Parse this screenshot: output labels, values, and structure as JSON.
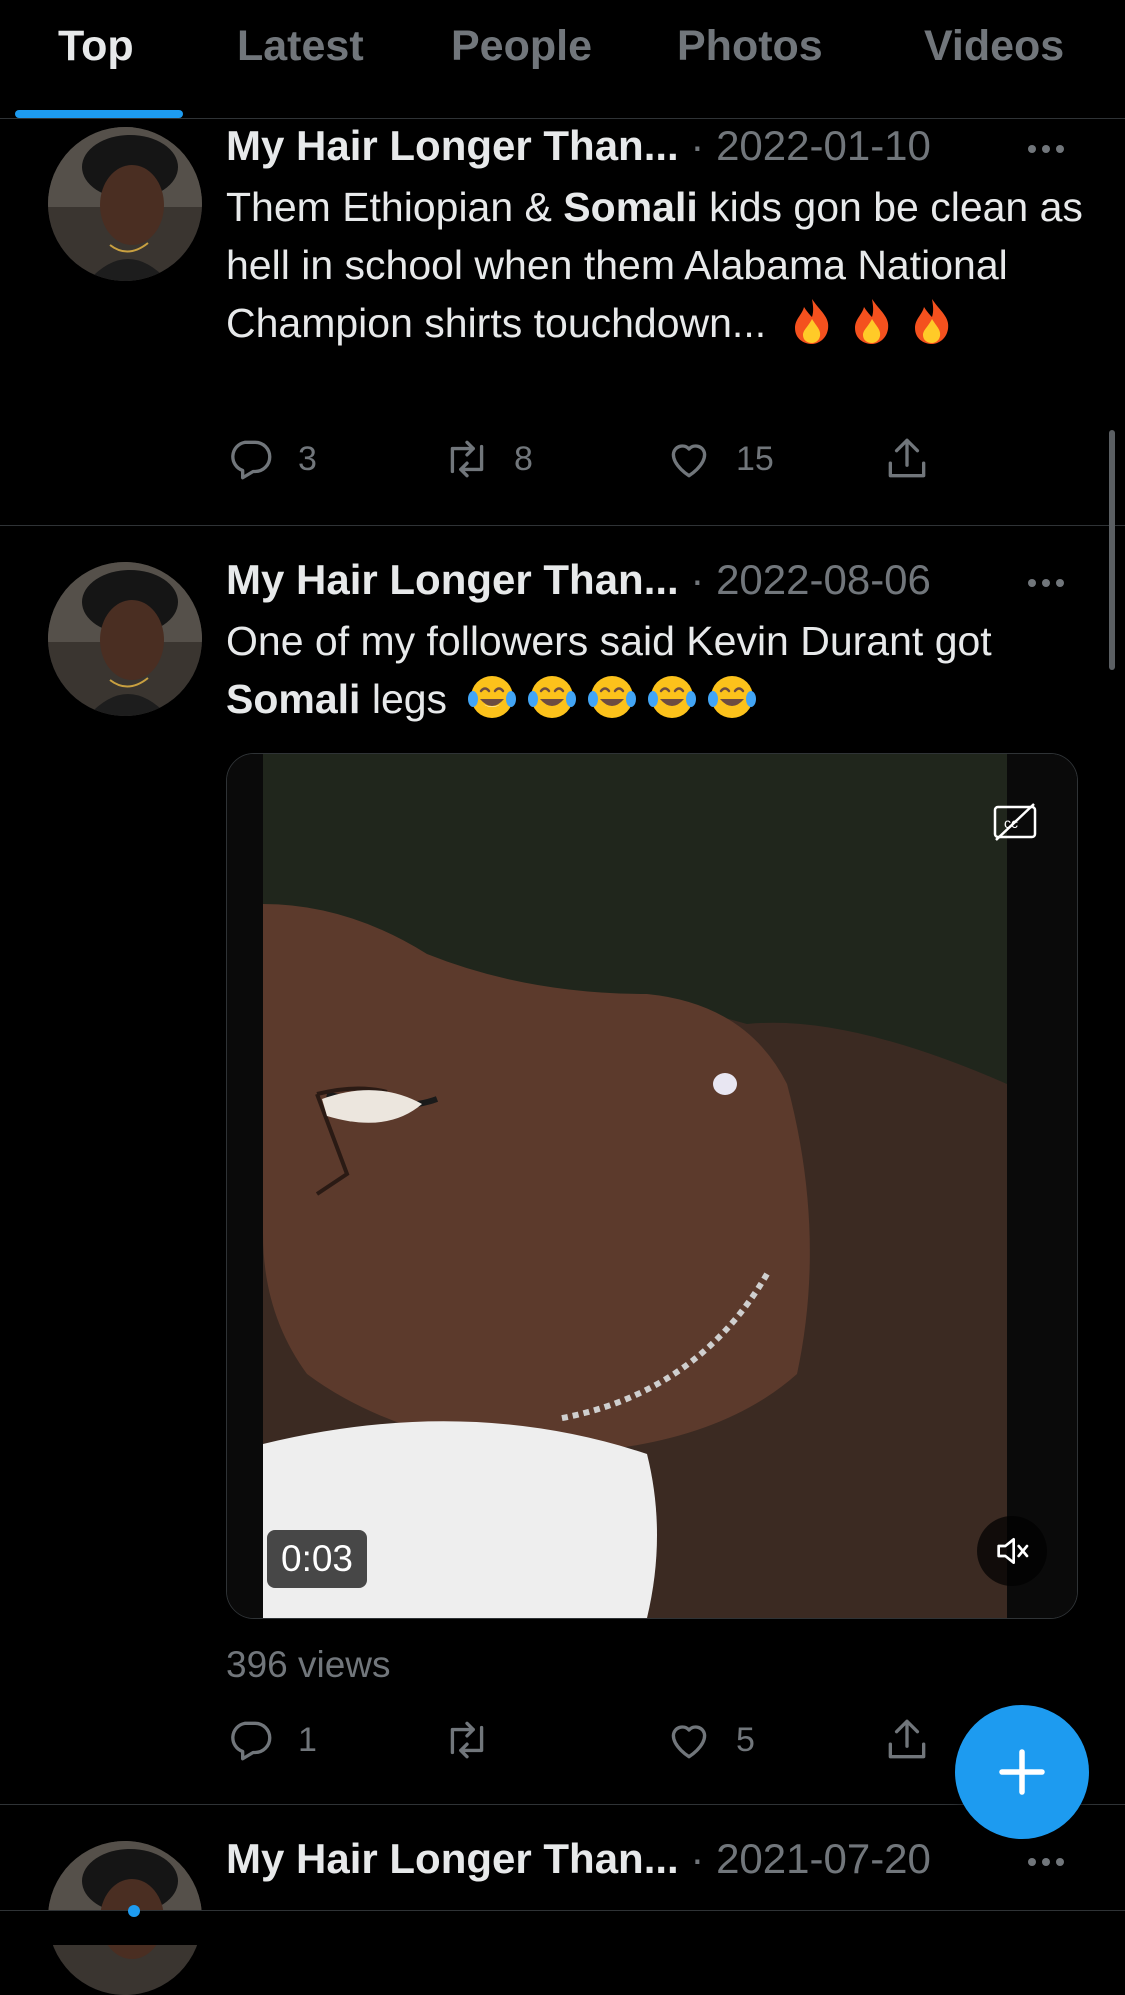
{
  "tabs": [
    {
      "label": "Top",
      "active": true
    },
    {
      "label": "Latest"
    },
    {
      "label": "People"
    },
    {
      "label": "Photos"
    },
    {
      "label": "Videos"
    }
  ],
  "colors": {
    "accent": "#1d9bf0",
    "background": "#000000",
    "muted": "#71767b",
    "text": "#e7e9ea"
  },
  "tweets": [
    {
      "author": "My Hair Longer Than...",
      "separator": "·",
      "date": "2022-01-10",
      "text_parts": [
        "Them Ethiopian & ",
        "Somali",
        " kids gon be clean as hell in school when them Alabama National Champion shirts touchdown... "
      ],
      "emojis": [
        "fire",
        "fire",
        "fire"
      ],
      "replies": "3",
      "retweets": "8",
      "likes": "15"
    },
    {
      "author": "My Hair Longer Than...",
      "separator": "·",
      "date": "2022-08-06",
      "text_parts": [
        "One of my followers said Kevin Durant got ",
        "Somali",
        " legs "
      ],
      "emojis": [
        "tears-of-joy",
        "tears-of-joy",
        "tears-of-joy",
        "tears-of-joy",
        "tears-of-joy"
      ],
      "video_duration": "0:03",
      "views": "396 views",
      "replies": "1",
      "retweets": "",
      "likes": "5"
    },
    {
      "author": "My Hair Longer Than...",
      "separator": "·",
      "date": "2021-07-20"
    }
  ],
  "icons": {
    "reply": "reply-icon",
    "retweet": "retweet-icon",
    "like": "heart-icon",
    "share": "share-icon",
    "more": "more-icon",
    "captions": "captions-icon",
    "mute": "muted-speaker-icon",
    "compose": "plus-icon"
  }
}
